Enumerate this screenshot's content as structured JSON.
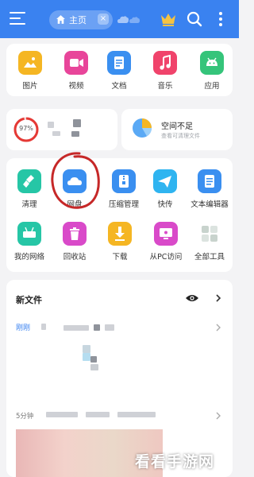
{
  "topbar": {
    "home_tab_label": "主页",
    "bg_color": "#3a82f0"
  },
  "categories": [
    {
      "label": "图片",
      "icon": "image-icon",
      "color": "#f5b623"
    },
    {
      "label": "视频",
      "icon": "video-icon",
      "color": "#e8459a"
    },
    {
      "label": "文档",
      "icon": "document-icon",
      "color": "#3a8ff0"
    },
    {
      "label": "音乐",
      "icon": "music-icon",
      "color": "#f0436b"
    },
    {
      "label": "应用",
      "icon": "android-icon",
      "color": "#35c47a"
    }
  ],
  "storage": {
    "percent_label": "97%",
    "percent_value": 97,
    "space_title": "空间不足",
    "space_subtitle": "查看可清理文件"
  },
  "tools": [
    {
      "label": "清理",
      "icon": "broom-icon",
      "color": "#26c6a6"
    },
    {
      "label": "网盘",
      "icon": "cloud-drive-icon",
      "color": "#3a8ff0"
    },
    {
      "label": "压缩管理",
      "icon": "zip-icon",
      "color": "#3a8ff0"
    },
    {
      "label": "快传",
      "icon": "send-icon",
      "color": "#2fb4f0"
    },
    {
      "label": "文本编辑器",
      "icon": "text-editor-icon",
      "color": "#3a8ff0"
    },
    {
      "label": "我的网络",
      "icon": "network-icon",
      "color": "#26c6a6"
    },
    {
      "label": "回收站",
      "icon": "trash-icon",
      "color": "#d94ac9"
    },
    {
      "label": "下载",
      "icon": "download-icon",
      "color": "#f5b623"
    },
    {
      "label": "从PC访问",
      "icon": "pc-access-icon",
      "color": "#d94ac9"
    },
    {
      "label": "全部工具",
      "icon": "all-tools-icon",
      "color": "#c8d3cd"
    }
  ],
  "new_files": {
    "title": "新文件",
    "group1_time": "刚刚",
    "group2_time": "5分钟"
  },
  "watermark": "看看手游网"
}
